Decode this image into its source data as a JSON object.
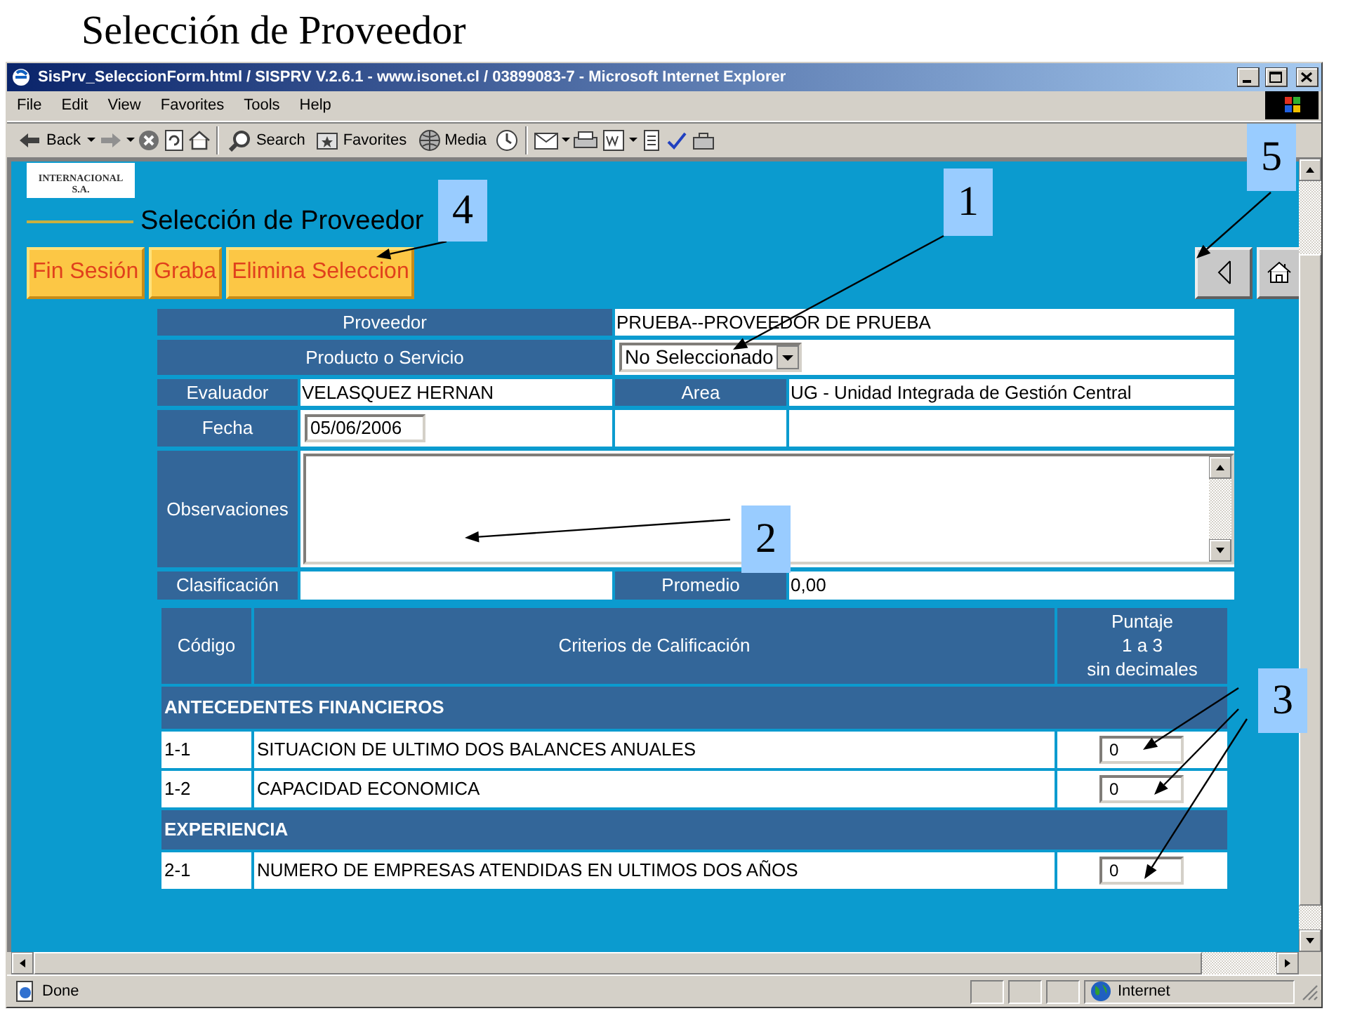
{
  "slide_title": "Selección de Proveedor",
  "window": {
    "title": "SisPrv_SeleccionForm.html / SISPRV V.2.6.1 - www.isonet.cl / 03899083-7 - Microsoft Internet Explorer"
  },
  "menu": [
    "File",
    "Edit",
    "View",
    "Favorites",
    "Tools",
    "Help"
  ],
  "toolbar": {
    "back": "Back",
    "search": "Search",
    "favorites": "Favorites",
    "media": "Media"
  },
  "logo": {
    "lines": [
      "INTERNACIONAL",
      "S.A."
    ]
  },
  "page_title": "Selección de Proveedor",
  "buttons": [
    "Fin Sesión",
    "Graba",
    "Elimina Seleccion"
  ],
  "form": {
    "proveedor": {
      "label": "Proveedor",
      "value": "PRUEBA--PROVEEDOR DE PRUEBA"
    },
    "producto": {
      "label": "Producto o Servicio",
      "value": "No Seleccionado"
    },
    "evaluador": {
      "label": "Evaluador",
      "value": "VELASQUEZ HERNAN"
    },
    "area": {
      "label": "Area",
      "value": "UG - Unidad Integrada de Gestión Central"
    },
    "fecha": {
      "label": "Fecha",
      "value": "05/06/2006"
    },
    "observaciones": {
      "label": "Observaciones"
    },
    "clasificacion": {
      "label": "Clasificación"
    },
    "promedio": {
      "label": "Promedio",
      "value": "0,00"
    }
  },
  "criteria": {
    "columns": [
      "Código",
      "Criterios de Calificación",
      "Puntaje\n1 a 3\nsin decimales"
    ],
    "rows": [
      {
        "kind": "section",
        "title": "ANTECEDENTES FINANCIEROS"
      },
      {
        "kind": "item",
        "code": "1-1",
        "text": "SITUACION DE ULTIMO DOS BALANCES ANUALES",
        "score": "0"
      },
      {
        "kind": "item",
        "code": "1-2",
        "text": "CAPACIDAD ECONOMICA",
        "score": "0"
      },
      {
        "kind": "section",
        "title": "EXPERIENCIA"
      },
      {
        "kind": "item",
        "code": "2-1",
        "text": "NUMERO DE EMPRESAS ATENDIDAS EN ULTIMOS DOS AÑOS",
        "score": "0"
      }
    ]
  },
  "status_bar": {
    "text": "Done",
    "zone": "Internet"
  },
  "callouts": [
    {
      "number": "1"
    },
    {
      "number": "2"
    },
    {
      "number": "3"
    },
    {
      "number": "4"
    },
    {
      "number": "5"
    }
  ]
}
